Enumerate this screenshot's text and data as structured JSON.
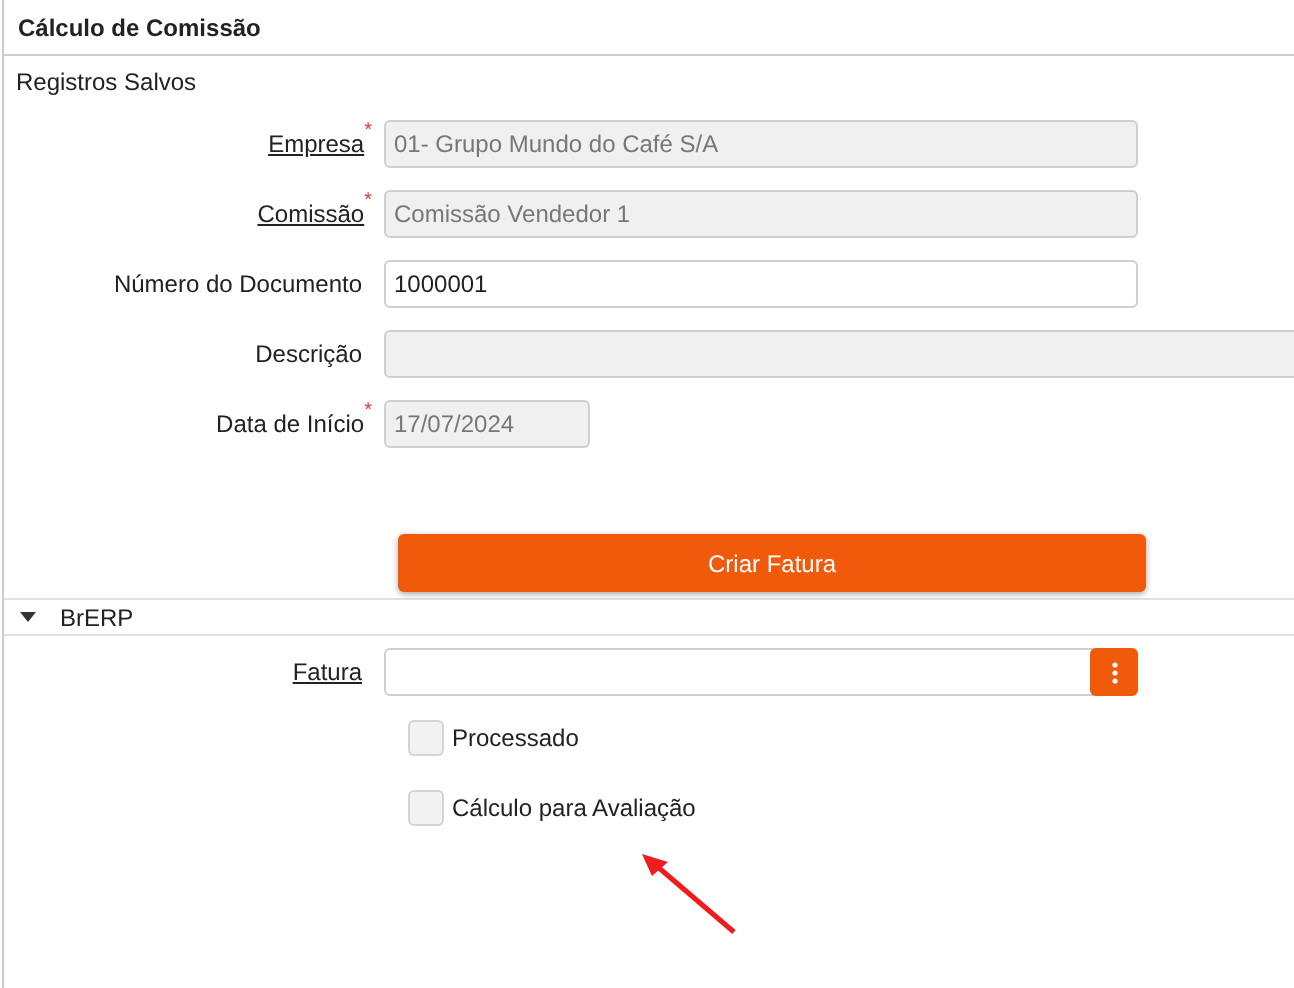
{
  "window": {
    "title": "Cálculo de Comissão"
  },
  "subtitle": "Registros Salvos",
  "fields": [
    {
      "label": "Empresa",
      "linked": true,
      "required_mark": "*",
      "value": "01- Grupo Mundo do Café S/A",
      "disabled": true,
      "kind": "text"
    },
    {
      "label": "Comissão",
      "linked": true,
      "required_mark": "*",
      "value": "Comissão Vendedor 1",
      "disabled": true,
      "kind": "text"
    },
    {
      "label": "Número do Documento",
      "linked": false,
      "value": "1000001",
      "disabled": false,
      "kind": "text"
    },
    {
      "label": "Descrição",
      "linked": false,
      "disabled": true,
      "kind": "memo"
    },
    {
      "label": "Data de Início",
      "linked": false,
      "required_mark": "*",
      "value": "17/07/2024",
      "disabled": true,
      "kind": "date"
    }
  ],
  "action_button": "Criar Fatura",
  "section": {
    "title": "BrERP",
    "expanded": true,
    "lookup": {
      "label": "Fatura",
      "linked": true
    },
    "checkboxes": [
      {
        "label": "Processado",
        "checked": false
      },
      {
        "label": "Cálculo para Avaliação",
        "checked": false
      }
    ]
  }
}
